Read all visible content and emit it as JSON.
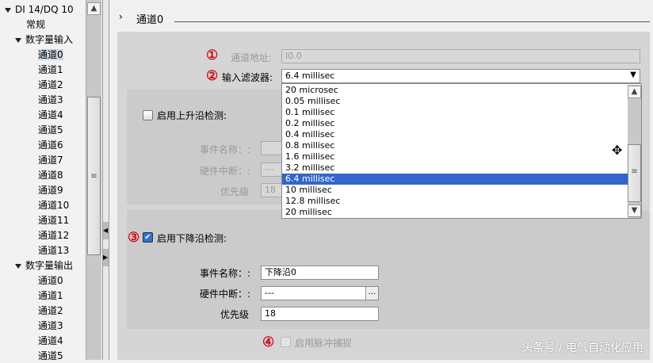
{
  "tree": {
    "root": "DI 14/DQ 10",
    "general": "常规",
    "di": "数字量输入",
    "di_channels": [
      "通道0",
      "通道1",
      "通道2",
      "通道3",
      "通道4",
      "通道5",
      "通道6",
      "通道7",
      "通道8",
      "通道9",
      "通道10",
      "通道11",
      "通道12",
      "通道13"
    ],
    "dq": "数字量输出",
    "dq_channels": [
      "通道0",
      "通道1",
      "通道2",
      "通道3",
      "通道4",
      "通道5"
    ]
  },
  "header": {
    "title": "通道0"
  },
  "form": {
    "marker1": "①",
    "address_label": "通道地址:",
    "address_value": "I0.0",
    "marker2": "②",
    "filter_label": "输入滤波器:",
    "filter_value": "6.4 millisec",
    "filter_options": [
      "20 microsec",
      "0.05 millisec",
      "0.1 millisec",
      "0.2 millisec",
      "0.4 millisec",
      "0.8 millisec",
      "1.6 millisec",
      "3.2 millisec",
      "6.4 millisec",
      "10 millisec",
      "12.8 millisec",
      "20 millisec"
    ],
    "rising": {
      "label": "启用上升沿检测:",
      "checked": false,
      "event_label": "事件名称：:",
      "hw_label": "硬件中断：:",
      "hw_value": "---",
      "prio_label": "优先级",
      "prio_value": "18"
    },
    "marker3": "③",
    "falling": {
      "label": "启用下降沿检测:",
      "checked": true,
      "event_label": "事件名称：:",
      "event_value": "下降沿0",
      "hw_label": "硬件中断：:",
      "hw_value": "---",
      "hw_button": "...",
      "prio_label": "优先级",
      "prio_value": "18"
    },
    "marker4": "④",
    "pulse_label": "启用脉冲捕捉"
  },
  "watermark": "头条号 / 电气自动化应用"
}
